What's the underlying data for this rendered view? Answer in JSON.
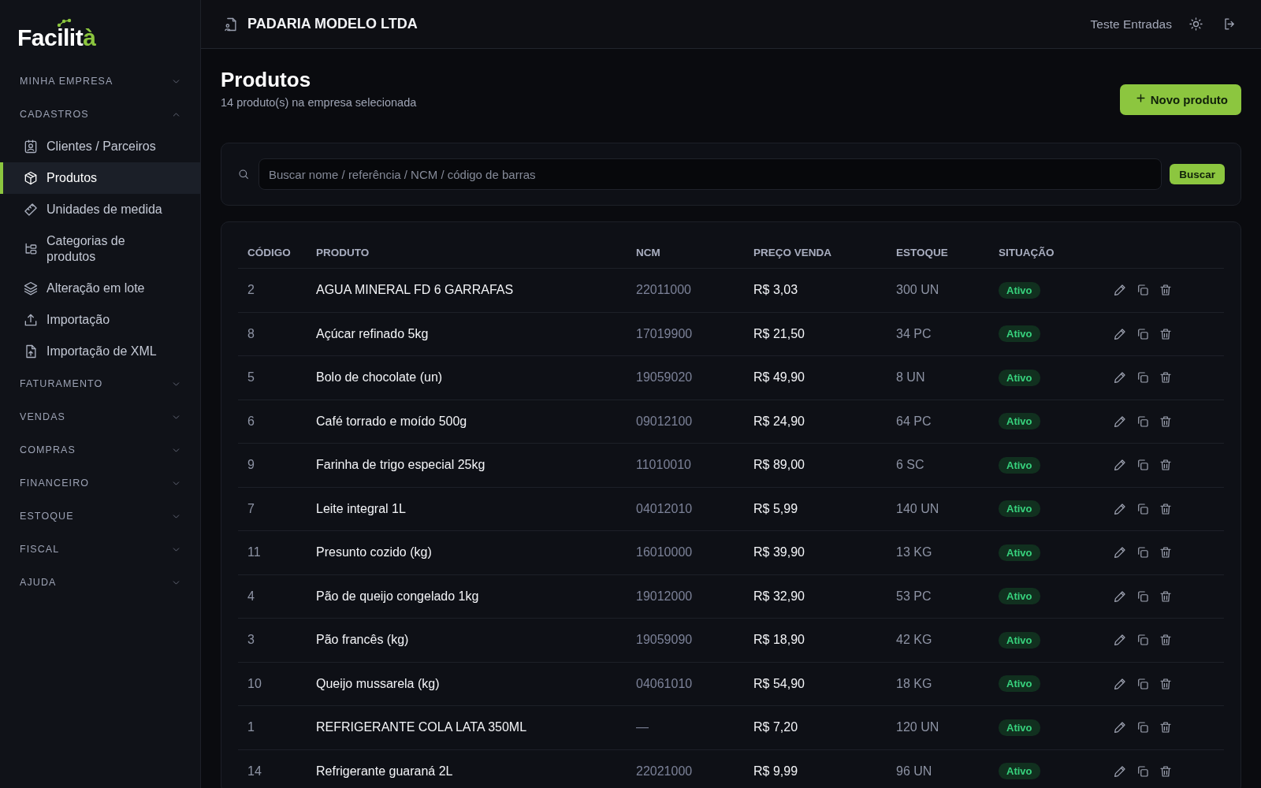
{
  "logo": {
    "text": "Facilit",
    "accent": "à"
  },
  "sidebar": {
    "sections": [
      {
        "label": "MINHA EMPRESA",
        "expanded": false
      },
      {
        "label": "CADASTROS",
        "expanded": true,
        "items": [
          {
            "label": "Clientes / Parceiros",
            "selected": false
          },
          {
            "label": "Produtos",
            "selected": true
          },
          {
            "label": "Unidades de medida",
            "selected": false
          },
          {
            "label": "Categorias de produtos",
            "selected": false
          },
          {
            "label": "Alteração em lote",
            "selected": false
          },
          {
            "label": "Importação",
            "selected": false
          },
          {
            "label": "Importação de XML",
            "selected": false
          }
        ]
      },
      {
        "label": "FATURAMENTO",
        "expanded": false
      },
      {
        "label": "VENDAS",
        "expanded": false
      },
      {
        "label": "COMPRAS",
        "expanded": false
      },
      {
        "label": "FINANCEIRO",
        "expanded": false
      },
      {
        "label": "ESTOQUE",
        "expanded": false
      },
      {
        "label": "FISCAL",
        "expanded": false
      },
      {
        "label": "AJUDA",
        "expanded": false
      }
    ]
  },
  "header": {
    "company": "PADARIA MODELO LTDA",
    "user": "Teste Entradas"
  },
  "page": {
    "title": "Produtos",
    "subtitle": "14 produto(s) na empresa selecionada",
    "new_button": "Novo produto"
  },
  "search": {
    "placeholder": "Buscar nome / referência / NCM / código de barras",
    "button": "Buscar"
  },
  "table": {
    "columns": [
      "CÓDIGO",
      "PRODUTO",
      "NCM",
      "PREÇO VENDA",
      "ESTOQUE",
      "SITUAÇÃO"
    ],
    "rows": [
      {
        "code": "2",
        "product": "AGUA MINERAL FD 6 GARRAFAS",
        "ncm": "22011000",
        "price": "R$ 3,03",
        "stock": "300 UN",
        "status": "Ativo"
      },
      {
        "code": "8",
        "product": "Açúcar refinado 5kg",
        "ncm": "17019900",
        "price": "R$ 21,50",
        "stock": "34 PC",
        "status": "Ativo"
      },
      {
        "code": "5",
        "product": "Bolo de chocolate (un)",
        "ncm": "19059020",
        "price": "R$ 49,90",
        "stock": "8 UN",
        "status": "Ativo"
      },
      {
        "code": "6",
        "product": "Café torrado e moído 500g",
        "ncm": "09012100",
        "price": "R$ 24,90",
        "stock": "64 PC",
        "status": "Ativo"
      },
      {
        "code": "9",
        "product": "Farinha de trigo especial 25kg",
        "ncm": "11010010",
        "price": "R$ 89,00",
        "stock": "6 SC",
        "status": "Ativo"
      },
      {
        "code": "7",
        "product": "Leite integral 1L",
        "ncm": "04012010",
        "price": "R$ 5,99",
        "stock": "140 UN",
        "status": "Ativo"
      },
      {
        "code": "11",
        "product": "Presunto cozido (kg)",
        "ncm": "16010000",
        "price": "R$ 39,90",
        "stock": "13 KG",
        "status": "Ativo"
      },
      {
        "code": "4",
        "product": "Pão de queijo congelado 1kg",
        "ncm": "19012000",
        "price": "R$ 32,90",
        "stock": "53 PC",
        "status": "Ativo"
      },
      {
        "code": "3",
        "product": "Pão francês (kg)",
        "ncm": "19059090",
        "price": "R$ 18,90",
        "stock": "42 KG",
        "status": "Ativo"
      },
      {
        "code": "10",
        "product": "Queijo mussarela (kg)",
        "ncm": "04061010",
        "price": "R$ 54,90",
        "stock": "18 KG",
        "status": "Ativo"
      },
      {
        "code": "1",
        "product": "REFRIGERANTE COLA LATA 350ML",
        "ncm": "—",
        "price": "R$ 7,20",
        "stock": "120 UN",
        "status": "Ativo"
      },
      {
        "code": "14",
        "product": "Refrigerante guaraná 2L",
        "ncm": "22021000",
        "price": "R$ 9,99",
        "stock": "96 UN",
        "status": "Ativo"
      }
    ]
  }
}
